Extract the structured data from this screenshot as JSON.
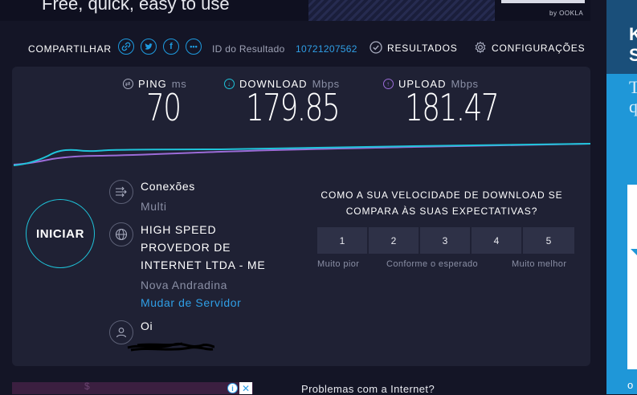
{
  "top_banner": {
    "text": "Free, quick, easy to use",
    "brand": "by OOKLA"
  },
  "share": {
    "label": "COMPARTILHAR",
    "icons": [
      "link-icon",
      "twitter-icon",
      "facebook-icon",
      "more-icon"
    ],
    "result_id_label": "ID do Resultado",
    "result_id_value": "10721207562",
    "results_label": "RESULTADOS",
    "settings_label": "CONFIGURAÇÕES"
  },
  "metrics": {
    "ping": {
      "label": "PING",
      "unit": "ms",
      "value": "70"
    },
    "download": {
      "label": "DOWNLOAD",
      "unit": "Mbps",
      "value": "179.85"
    },
    "upload": {
      "label": "UPLOAD",
      "unit": "Mbps",
      "value": "181.47"
    }
  },
  "start_button": "INICIAR",
  "connections": {
    "title": "Conexões",
    "value": "Multi"
  },
  "server": {
    "isp_lines": [
      "HIGH SPEED",
      "PROVEDOR DE",
      "INTERNET LTDA - ME"
    ],
    "location": "Nova Andradina",
    "change_link": "Mudar de Servidor"
  },
  "user": {
    "provider": "Oi"
  },
  "survey": {
    "question_line1": "COMO A SUA VELOCIDADE DE DOWNLOAD SE",
    "question_line2": "COMPARA ÀS SUAS EXPECTATIVAS?",
    "options": [
      "1",
      "2",
      "3",
      "4",
      "5"
    ],
    "label_low": "Muito pior",
    "label_mid": "Conforme o esperado",
    "label_high": "Muito melhor"
  },
  "bottom": {
    "problems_text": "Problemas com a Internet?",
    "ad_glyph": "$"
  },
  "right_ad": {
    "line1": "K",
    "line2": "S",
    "line3": "T",
    "line4": "q",
    "line5": "o"
  },
  "colors": {
    "background": "#141526",
    "panel": "#1f2134",
    "accent_cyan": "#1fc4da",
    "accent_purple": "#9b6cd8",
    "link_blue": "#2f9fe6"
  }
}
